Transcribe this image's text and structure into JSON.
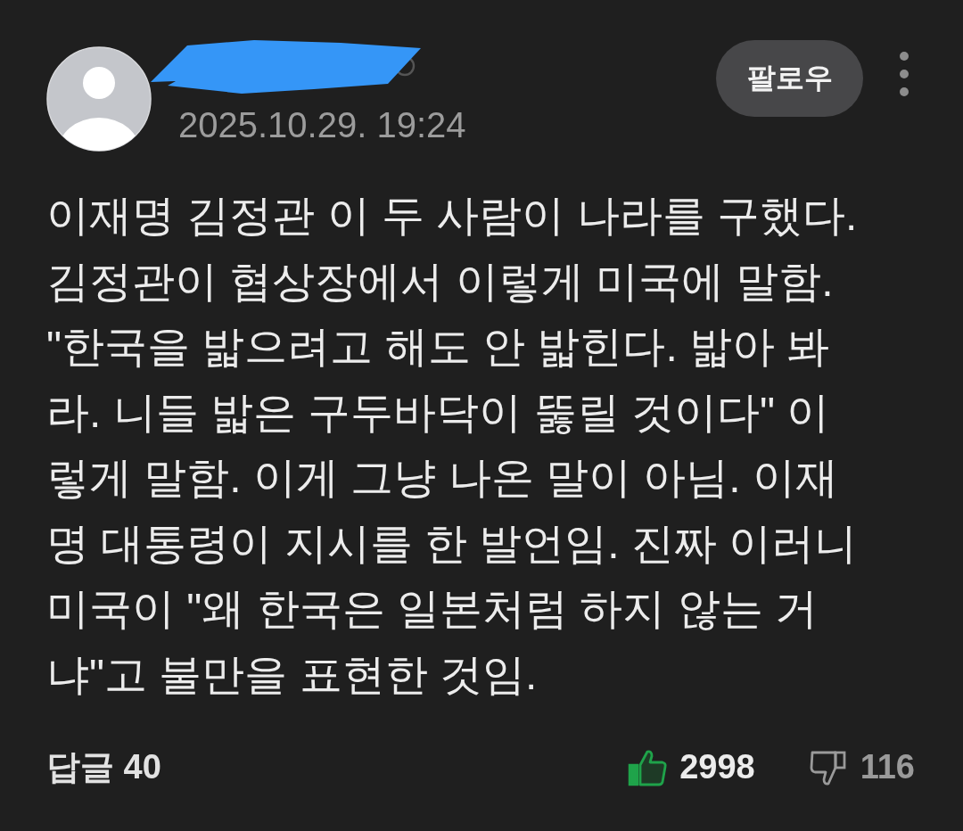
{
  "comment": {
    "timestamp": "2025.10.29. 19:24",
    "follow_button": "팔로우",
    "body": "이재명 김정관 이 두 사람이 나라를 구했다. 김정관이 협상장에서 이렇게 미국에 말함. \"한국을 밟으려고 해도 안 밟힌다. 밟아 봐라. 니들 밟은 구두바닥이 뚫릴 것이다\" 이렇게 말함. 이게 그냥 나온 말이 아님. 이재명 대통령이 지시를 한 발언임. 진짜 이러니 미국이 \"왜 한국은 일본처럼 하지 않는 거냐\"고 불만을 표현한 것임.",
    "replies": "답글 40",
    "reactions": [
      {
        "kind": "like",
        "count": "2998",
        "selected": true
      },
      {
        "kind": "dislike",
        "count": "116",
        "selected": false
      }
    ]
  }
}
